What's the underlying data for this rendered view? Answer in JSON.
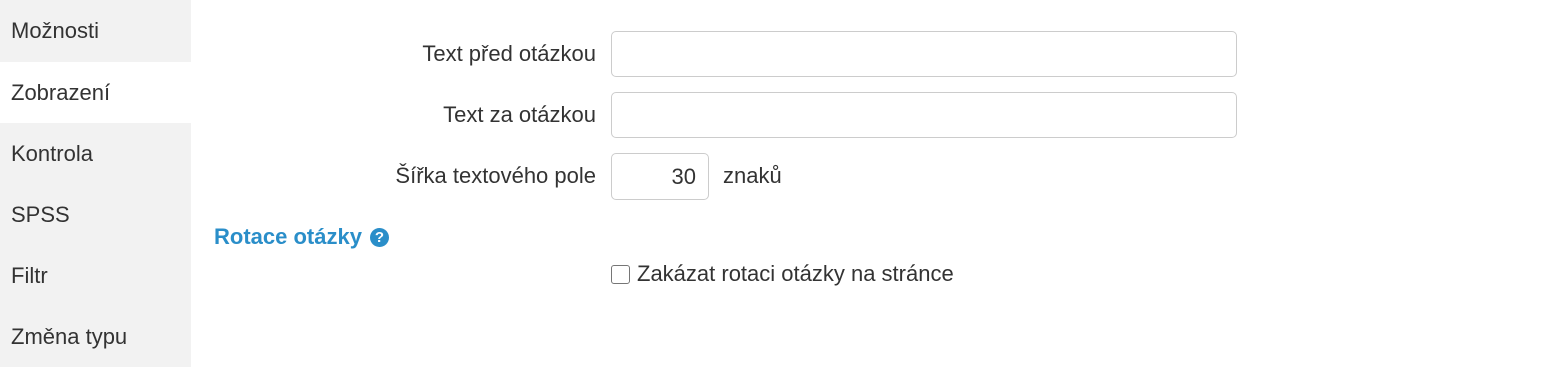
{
  "sidebar": {
    "items": [
      {
        "label": "Možnosti",
        "active": false
      },
      {
        "label": "Zobrazení",
        "active": true
      },
      {
        "label": "Kontrola",
        "active": false
      },
      {
        "label": "SPSS",
        "active": false
      },
      {
        "label": "Filtr",
        "active": false
      },
      {
        "label": "Změna typu",
        "active": false
      }
    ]
  },
  "form": {
    "text_before": {
      "label": "Text před otázkou",
      "value": ""
    },
    "text_after": {
      "label": "Text za otázkou",
      "value": ""
    },
    "field_width": {
      "label": "Šířka textového pole",
      "value": "30",
      "suffix": "znaků"
    }
  },
  "rotation": {
    "title": "Rotace otázky",
    "help_icon": "question-circle-icon",
    "help_glyph": "?",
    "checkbox_label": "Zakázat rotaci otázky na stránce",
    "checked": false
  },
  "colors": {
    "accent": "#2a8ec9",
    "sidebar_bg": "#f2f2f2",
    "border": "#cccccc"
  }
}
